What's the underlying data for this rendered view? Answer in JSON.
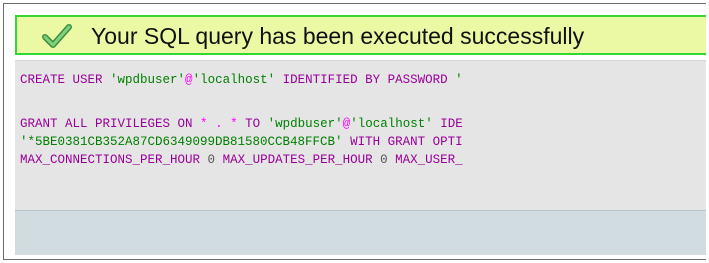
{
  "message": {
    "icon": "checkmark-icon",
    "text": "Your SQL query has been executed successfully",
    "colors": {
      "background": "#ebf8a4",
      "border": "#33d633",
      "check": "#5cb85c"
    }
  },
  "sql": {
    "line1": {
      "t1": "CREATE USER",
      "t2": "'wpdbuser'",
      "t3": "@",
      "t4": "'localhost'",
      "t5": "IDENTIFIED BY PASSWORD",
      "t6": "'"
    },
    "line2": {
      "t1": "GRANT ALL PRIVILEGES ON",
      "t2": "*",
      "t3": ".",
      "t4": "*",
      "t5": "TO",
      "t6": "'wpdbuser'",
      "t7": "@",
      "t8": "'localhost'",
      "t9": "IDE"
    },
    "line3": {
      "t1": "'*5BE0381CB352A87CD6349099DB81580CCB48FFCB'",
      "t2": "WITH GRANT OPTI"
    },
    "line4": {
      "t1": "MAX_CONNECTIONS_PER_HOUR",
      "t2": "0",
      "t3": "MAX_UPDATES_PER_HOUR",
      "t4": "0",
      "t5": "MAX_USER_"
    },
    "colors": {
      "keyword": "#990099",
      "string": "#008000",
      "operator": "#ff00ff",
      "background": "#e5e5e5"
    }
  }
}
